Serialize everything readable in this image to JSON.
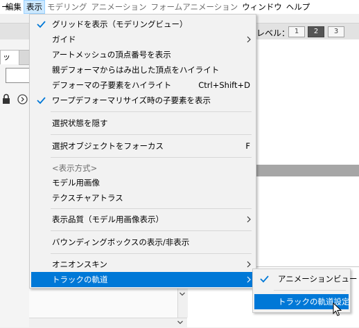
{
  "menubar": {
    "items": [
      {
        "label": "ー"
      },
      {
        "label": "編集"
      },
      {
        "label": "表示"
      },
      {
        "label": "モデリング"
      },
      {
        "label": "アニメーション"
      },
      {
        "label": "フォームアニメーション"
      },
      {
        "label": "ウィンドウ"
      },
      {
        "label": "ヘルプ"
      }
    ]
  },
  "toolbar": {
    "level_label": "レベル：",
    "level_buttons": [
      "1",
      "2",
      "3"
    ],
    "selected_level": "2"
  },
  "left_panel": {
    "tab_label": "ッ"
  },
  "view_menu": {
    "items": [
      {
        "label": "グリッドを表示（モデリングビュー）",
        "checked": true
      },
      {
        "label": "ガイド",
        "submenu": true
      },
      {
        "label": "アートメッシュの頂点番号を表示"
      },
      {
        "label": "親デフォーマからはみ出した頂点をハイライト"
      },
      {
        "label": "デフォーマの子要素をハイライト",
        "shortcut": "Ctrl+Shift+D"
      },
      {
        "label": "ワープデフォーマリサイズ時の子要素を表示",
        "checked": true
      },
      {
        "label": "選択状態を隠す"
      },
      {
        "label": "選択オブジェクトをフォーカス",
        "shortcut": "F"
      },
      {
        "label": "<表示方式>",
        "disabled": true
      },
      {
        "label": "モデル用画像"
      },
      {
        "label": "テクスチャアトラス"
      },
      {
        "label": "表示品質（モデル用画像表示）",
        "submenu": true
      },
      {
        "label": "バウンディングボックスの表示/非表示"
      },
      {
        "label": "オニオンスキン",
        "submenu": true
      },
      {
        "label": "トラックの軌道",
        "submenu": true,
        "highlighted": true
      }
    ]
  },
  "track_submenu": {
    "items": [
      {
        "label": "アニメーションビュー",
        "checked": true
      },
      {
        "label": "トラックの軌道設定",
        "highlighted": true
      }
    ]
  },
  "colors": {
    "highlight": "#0078d7",
    "check": "#0078d7",
    "menu_bg": "#f2f2f2"
  }
}
